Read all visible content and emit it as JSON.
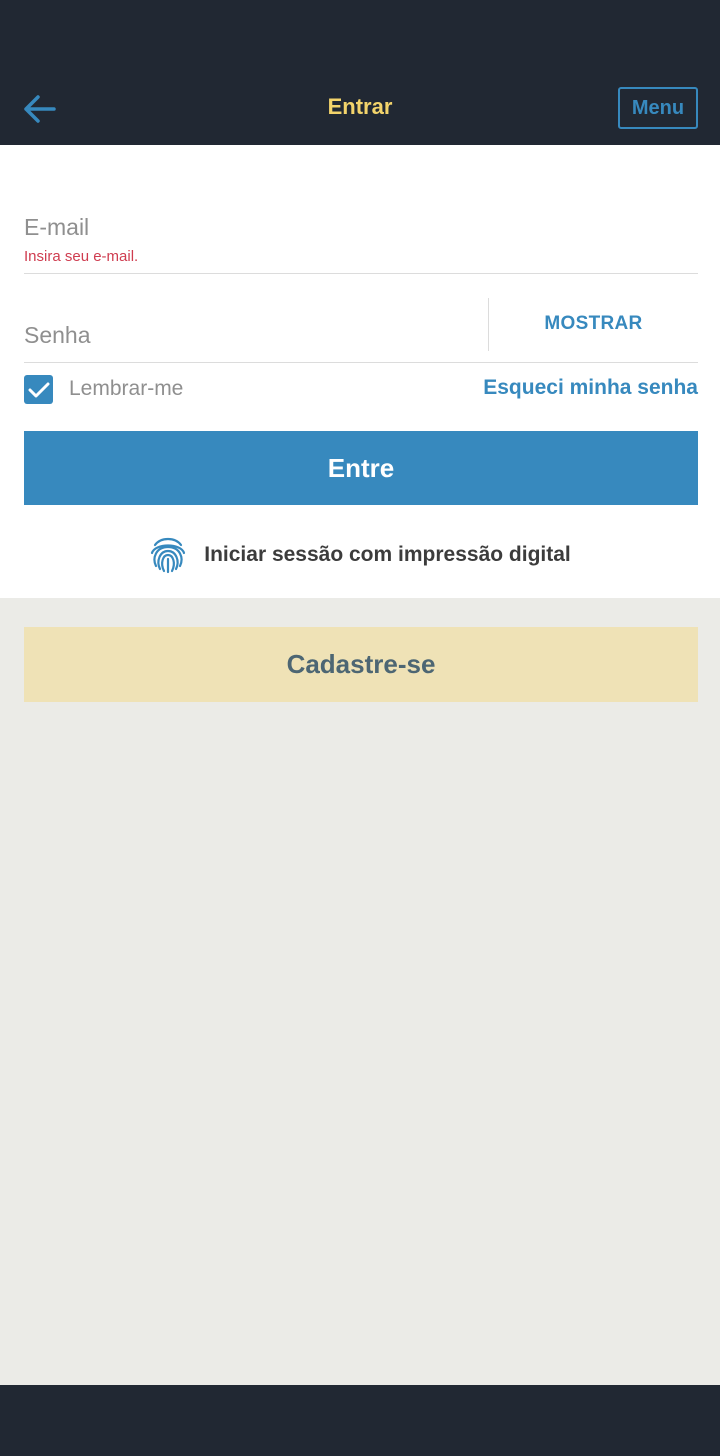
{
  "header": {
    "back_icon": "arrow-left-icon",
    "title": "Entrar",
    "menu_label": "Menu"
  },
  "form": {
    "email_placeholder": "E-mail",
    "email_error": "Insira seu e-mail.",
    "password_placeholder": "Senha",
    "show_password_label": "MOSTRAR",
    "remember_label": "Lembrar-me",
    "remember_checked": true,
    "forgot_label": "Esqueci minha senha",
    "submit_label": "Entre",
    "fingerprint_icon": "fingerprint-icon",
    "fingerprint_label": "Iniciar sessão com impressão digital"
  },
  "signup": {
    "label": "Cadastre-se"
  },
  "colors": {
    "header_bg": "#212833",
    "title": "#f3d46b",
    "accent": "#3789be",
    "error": "#cf3d50",
    "signup_bg": "#efe2b6",
    "page_bg": "#ebebe7"
  }
}
